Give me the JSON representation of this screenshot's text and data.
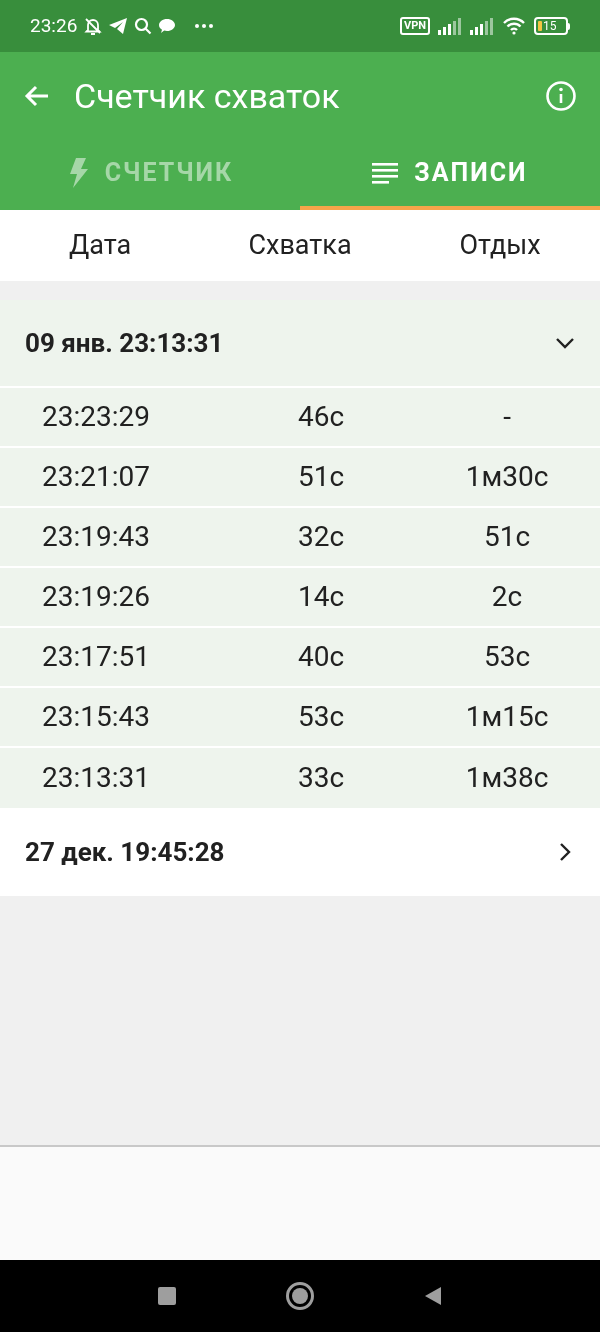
{
  "status_bar": {
    "time": "23:26",
    "vpn": "VPN",
    "battery": "15"
  },
  "toolbar": {
    "title": "Счетчик схваток"
  },
  "tabs": [
    {
      "label": "СЧЕТЧИК",
      "kind": "bolt",
      "selected": false
    },
    {
      "label": "ЗАПИСИ",
      "kind": "list",
      "selected": true
    }
  ],
  "table": {
    "columns": [
      "Дата",
      "Схватка",
      "Отдых"
    ],
    "groups": [
      {
        "title": "09 янв. 23:13:31",
        "expanded": true,
        "rows": [
          [
            "23:23:29",
            "46с",
            "-"
          ],
          [
            "23:21:07",
            "51с",
            "1м30с"
          ],
          [
            "23:19:43",
            "32с",
            "51с"
          ],
          [
            "23:19:26",
            "14с",
            "2с"
          ],
          [
            "23:17:51",
            "40с",
            "53с"
          ],
          [
            "23:15:43",
            "53с",
            "1м15с"
          ],
          [
            "23:13:31",
            "33с",
            "1м38с"
          ]
        ]
      },
      {
        "title": "27 дек. 19:45:28",
        "expanded": false
      }
    ]
  }
}
